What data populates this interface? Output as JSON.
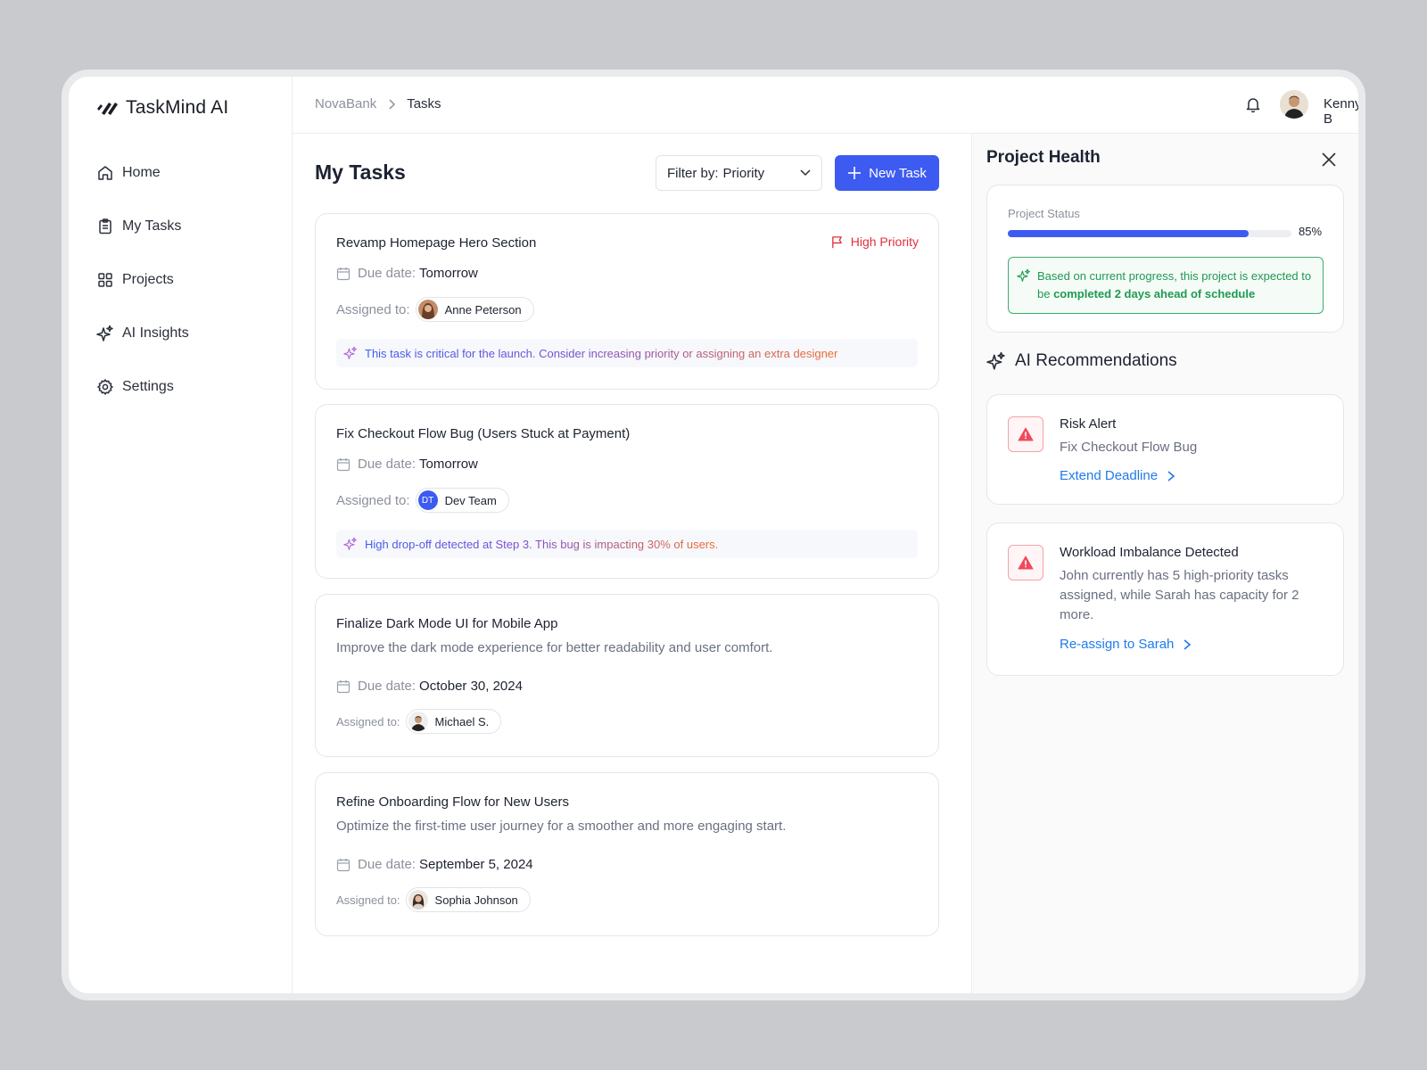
{
  "app": {
    "name": "TaskMind AI"
  },
  "sidebar": {
    "items": [
      {
        "label": "Home",
        "icon": "home-icon"
      },
      {
        "label": "My Tasks",
        "icon": "clipboard-icon"
      },
      {
        "label": "Projects",
        "icon": "grid-icon"
      },
      {
        "label": "AI Insights",
        "icon": "sparkle-icon"
      },
      {
        "label": "Settings",
        "icon": "gear-icon"
      }
    ]
  },
  "header": {
    "breadcrumb": {
      "parent": "NovaBank",
      "current": "Tasks"
    },
    "user": {
      "name": "Kenny B"
    }
  },
  "main": {
    "title": "My Tasks",
    "filter": {
      "label": "Filter by:",
      "value": "Priority"
    },
    "new_task_label": "New Task",
    "due_label": "Due date:",
    "assign_label": "Assigned to:",
    "tasks": [
      {
        "title": "Revamp Homepage Hero Section",
        "priority": "High Priority",
        "due": "Tomorrow",
        "assignee": "Anne Peterson",
        "ai_note": "This task is critical for the launch. Consider increasing priority or assigning an extra designer"
      },
      {
        "title": "Fix Checkout Flow Bug (Users Stuck at Payment)",
        "due": "Tomorrow",
        "assignee": "Dev Team",
        "assignee_initials": "DT",
        "ai_note": "High drop-off detected at Step 3. This bug is impacting 30% of users."
      },
      {
        "title": "Finalize Dark Mode UI for Mobile App",
        "description": "Improve the dark mode experience for better readability and user comfort.",
        "due": "October 30, 2024",
        "assignee": "Michael S."
      },
      {
        "title": "Refine Onboarding Flow for New Users",
        "description": "Optimize the first-time user journey for a smoother and more engaging start.",
        "due": "September 5, 2024",
        "assignee": "Sophia Johnson"
      }
    ]
  },
  "panel": {
    "title": "Project Health",
    "status_label": "Project Status",
    "progress": 85,
    "progress_label": "85%",
    "forecast_prefix": "Based on current progress, this project is expected to be",
    "forecast_bold": "completed 2 days ahead of schedule",
    "recommendations_title": "AI Recommendations",
    "recommendations": [
      {
        "title": "Risk Alert",
        "text": "Fix Checkout Flow Bug",
        "action": "Extend Deadline"
      },
      {
        "title": "Workload Imbalance Detected",
        "text": "John currently has 5 high-priority tasks assigned, while Sarah has capacity for 2 more.",
        "action": "Re-assign to Sarah"
      }
    ]
  },
  "colors": {
    "accent": "#3d5bf0",
    "danger": "#e0303e",
    "success": "#1f9a52",
    "link": "#1e7bea"
  }
}
